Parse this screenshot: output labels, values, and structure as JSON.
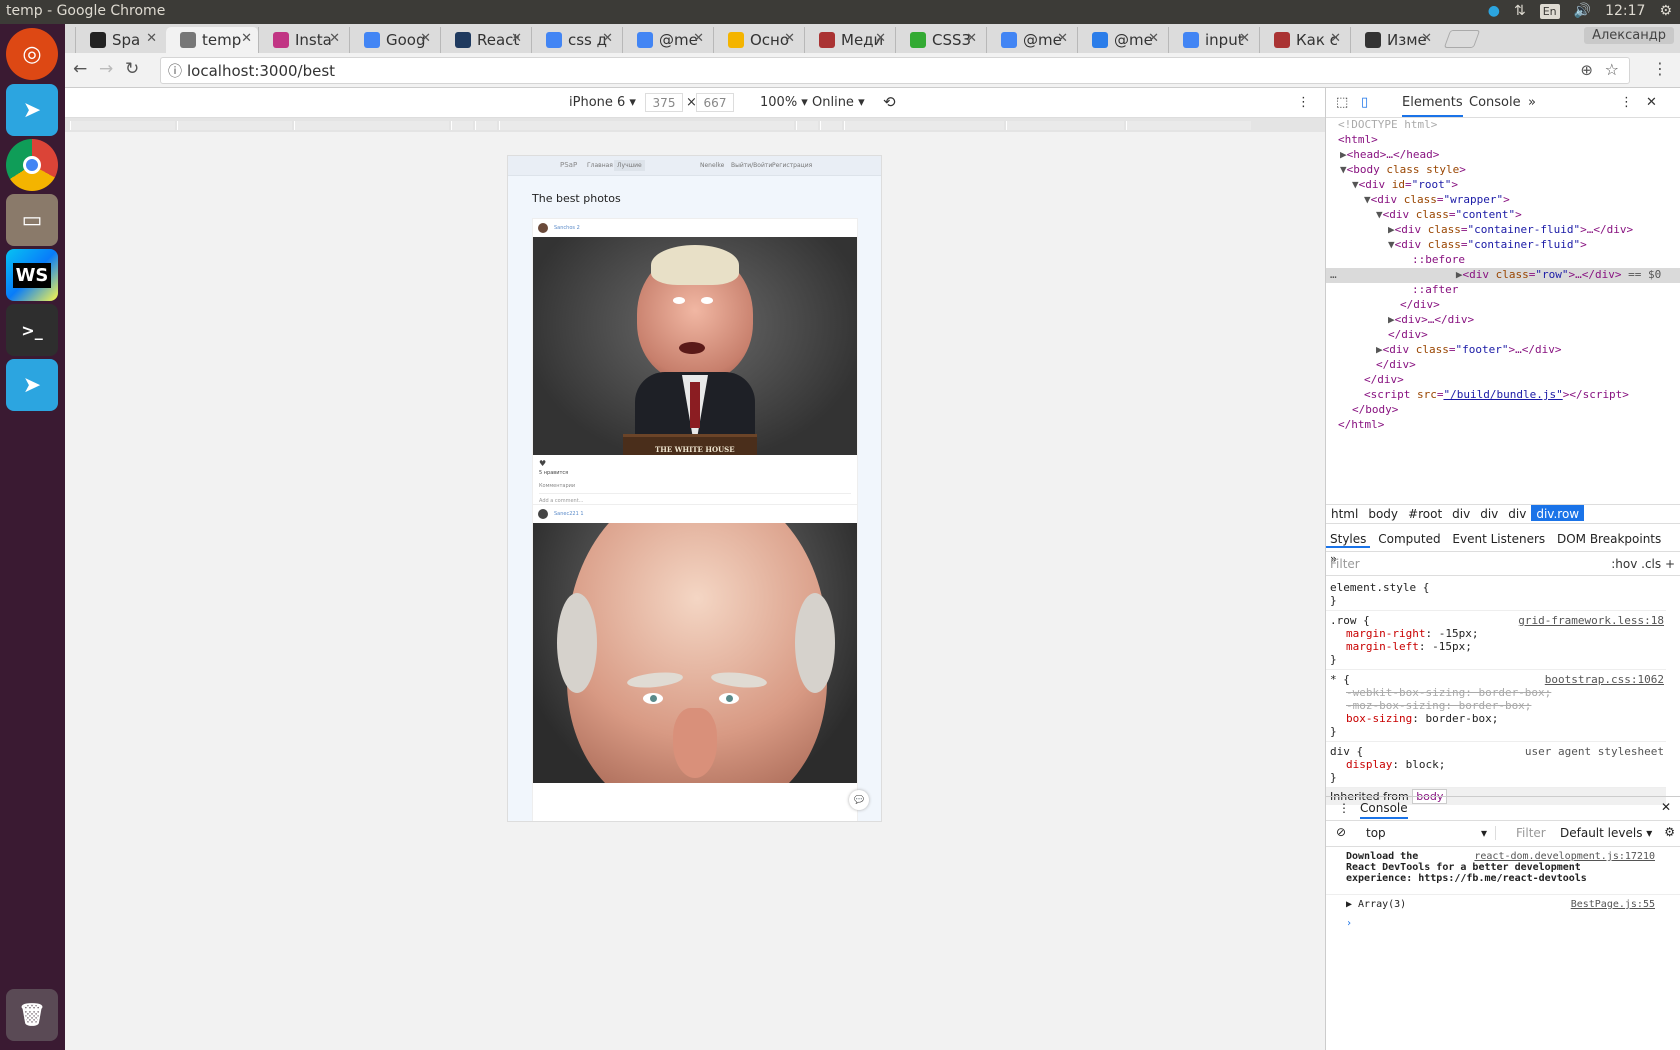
{
  "os": {
    "window_title": "temp - Google Chrome",
    "lang": "En",
    "time": "12:17",
    "user": "Александр"
  },
  "launcher": [
    "ubuntu-icon",
    "telegram-icon",
    "chrome-icon",
    "files-icon",
    "webstorm-icon",
    "terminal-icon",
    "telegram-icon",
    "trash-icon"
  ],
  "tabs": [
    {
      "label": "Spa",
      "color": "#222"
    },
    {
      "label": "temp",
      "color": "#777"
    },
    {
      "label": "Insta",
      "color": "#c13584"
    },
    {
      "label": "Goog",
      "color": "#4285f4"
    },
    {
      "label": "React",
      "color": "#1f3a5f"
    },
    {
      "label": "css д",
      "color": "#4285f4"
    },
    {
      "label": "@me",
      "color": "#4285f4"
    },
    {
      "label": "Осно",
      "color": "#f4b400"
    },
    {
      "label": "Меди",
      "color": "#a33"
    },
    {
      "label": "CSS3",
      "color": "#3a3"
    },
    {
      "label": "@me",
      "color": "#4285f4"
    },
    {
      "label": "@me",
      "color": "#2b7de9"
    },
    {
      "label": "input",
      "color": "#4285f4"
    },
    {
      "label": "Как с",
      "color": "#a33"
    },
    {
      "label": "Изме",
      "color": "#333"
    }
  ],
  "address": {
    "url": "localhost:3000/best"
  },
  "device": {
    "name": "iPhone 6 ▾",
    "width": "375",
    "height": "667",
    "x": "×",
    "zoom": "100% ▾",
    "network": "Online ▾"
  },
  "app": {
    "brand": "PSaP",
    "nav": [
      "Главная",
      "Лучшие"
    ],
    "nav_right": [
      "Nenelke",
      "Выйти/Войти",
      "Регистрация"
    ],
    "title": "The best photos",
    "posts": [
      {
        "user": "Sanchos 2",
        "likes": "5 нравится",
        "comments": "Комментарии",
        "comment_placeholder": "Add a comment...",
        "caption": "THE WHITE HOUSE"
      },
      {
        "user": "Sanec221 1"
      }
    ]
  },
  "devtools": {
    "tabs": [
      "Elements",
      "Console",
      "»"
    ],
    "crumbs": [
      "html",
      "body",
      "#root",
      "div",
      "div",
      "div",
      "div.row"
    ],
    "subtabs": [
      "Styles",
      "Computed",
      "Event Listeners",
      "DOM Breakpoints",
      "»"
    ],
    "filter": "Filter",
    "hov": ":hov .cls +",
    "console_tab": "Console",
    "context": "top",
    "cfilter": "Filter",
    "levels": "Default levels ▾",
    "msg1": "Download the\nReact DevTools for a better development\nexperience: https://fb.me/react-devtools",
    "msg1_src": "react-dom.development.js:17210",
    "msg2": "▶ Array(3)",
    "msg2_src": "BestPage.js:55",
    "inherited": "Inherited from"
  }
}
